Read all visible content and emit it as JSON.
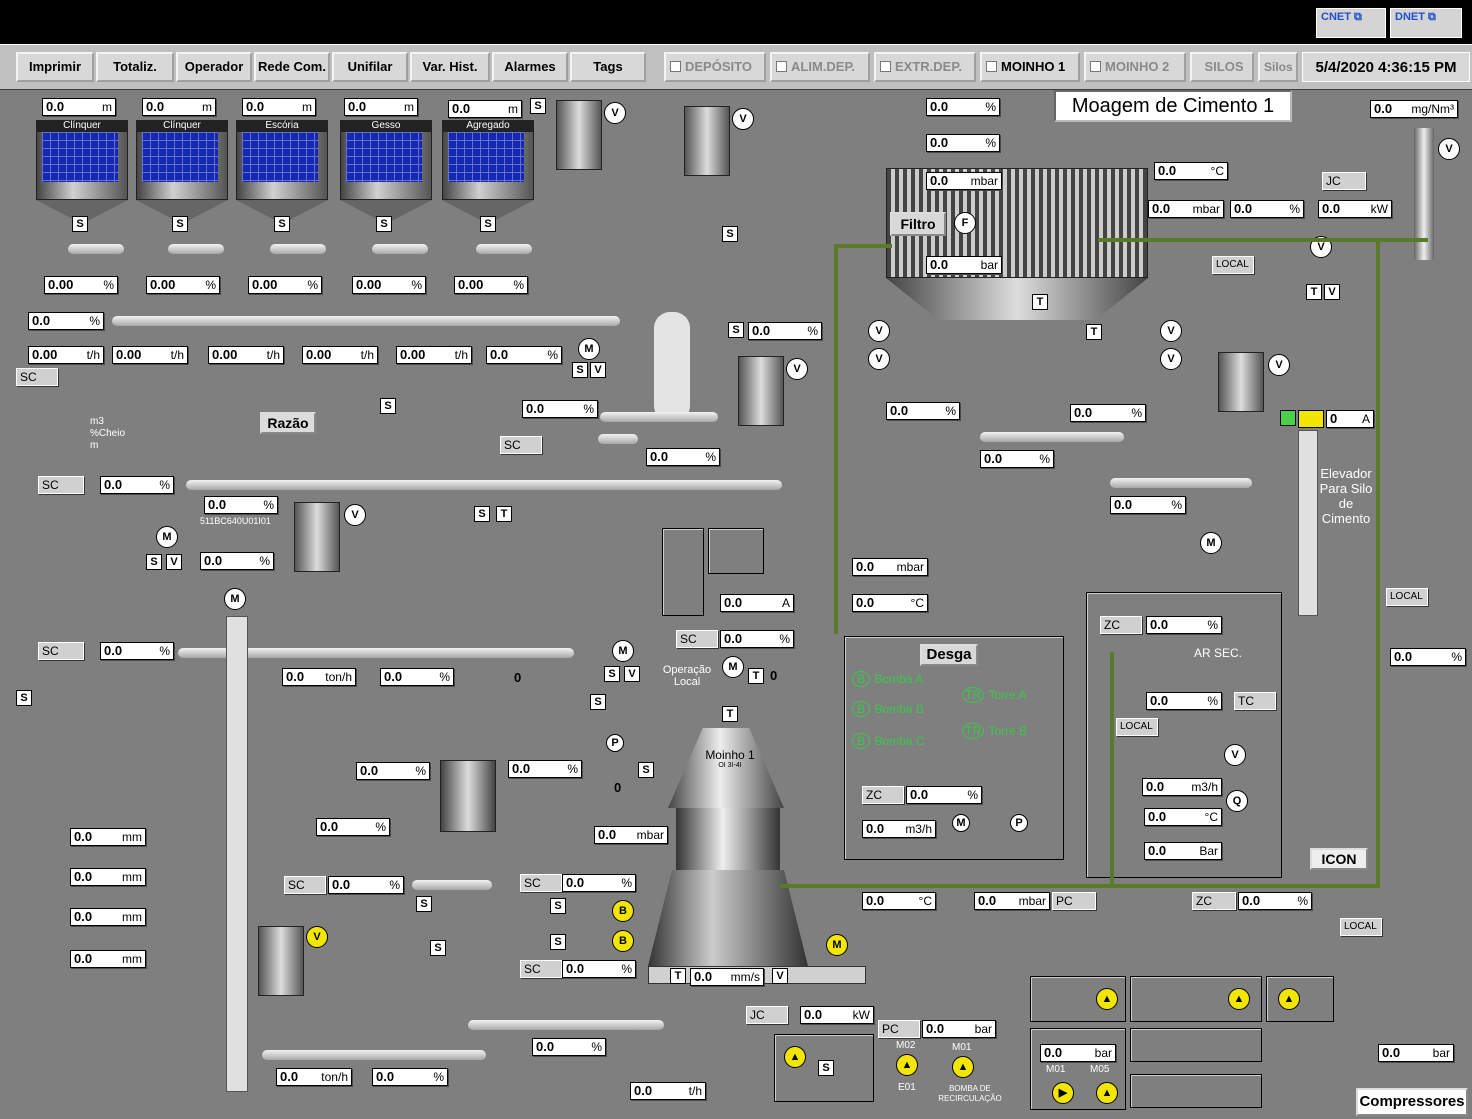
{
  "net": {
    "cnet": "CNET",
    "dnet": "DNET"
  },
  "menu": [
    "Imprimir",
    "Totaliz.",
    "Operador",
    "Rede Com.",
    "Unifilar",
    "Var. Hist.",
    "Alarmes",
    "Tags"
  ],
  "areas": [
    {
      "label": "DEPÓSITO",
      "active": false
    },
    {
      "label": "ALIM.DEP.",
      "active": false
    },
    {
      "label": "EXTR.DEP.",
      "active": false
    },
    {
      "label": "MOINHO 1",
      "active": true
    },
    {
      "label": "MOINHO 2",
      "active": false
    },
    {
      "label": "SILOS",
      "active": false
    },
    {
      "label": "Silos",
      "active": false
    }
  ],
  "datetime": "5/4/2020  4:36:15 PM",
  "title": "Moagem de Cimento 1",
  "silos": [
    {
      "label": "Clínquer",
      "top": "0.0",
      "unit": "m",
      "pct": "0.00"
    },
    {
      "label": "Clínquer",
      "top": "0.0",
      "unit": "m",
      "pct": "0.00"
    },
    {
      "label": "Escória",
      "top": "0.0",
      "unit": "m",
      "pct": "0.00"
    },
    {
      "label": "Gesso",
      "top": "0.0",
      "unit": "m",
      "pct": "0.00"
    },
    {
      "label": "Agregado",
      "top": "0.0",
      "unit": "m",
      "pct": "0.00"
    }
  ],
  "flows": [
    {
      "v": "0.00",
      "u": "t/h"
    },
    {
      "v": "0.00",
      "u": "t/h"
    },
    {
      "v": "0.00",
      "u": "t/h"
    },
    {
      "v": "0.00",
      "u": "t/h"
    },
    {
      "v": "0.00",
      "u": "t/h"
    },
    {
      "v": "0.0",
      "u": "%"
    }
  ],
  "labels": {
    "razao": "Razão",
    "m3": "m3",
    "cheio": "%Cheio",
    "m": "m",
    "tag511": "511BC640U01I01",
    "filtro": "Filtro",
    "elevador": "Elevador Para Silo de Cimento",
    "moinho": "Moinho 1",
    "moinho_sub": "OI 3I-4I",
    "operacao": "Operação Local",
    "desga": "Desga",
    "bomba_a": "Bomba A",
    "bomba_b": "Bomba B",
    "bomba_c": "Bomba C",
    "torre_a": "Torre A",
    "torre_b": "Torre B",
    "ar_sec": "AR SEC.",
    "icon": "ICON",
    "compressores": "Compressores",
    "local": "LOCAL",
    "bomba_recirc": "BOMBA DE RECIRCULAÇÃO",
    "m02": "M02",
    "m01": "M01",
    "e01": "E01",
    "m05": "M05",
    "zero": "0"
  },
  "fields": {
    "pct": "%",
    "zero": "0.0",
    "mgnm3": "mg/Nm³",
    "degc": "°C",
    "mbar": "mbar",
    "kw": "kW",
    "bar": "bar",
    "th": "t/h",
    "tonh": "ton/h",
    "mm": "mm",
    "a": "A",
    "m3h": "m3/h",
    "mms": "mm/s",
    "bar_cap": "Bar"
  },
  "tags": {
    "sc": "SC",
    "zc": "ZC",
    "jc": "JC",
    "pc": "PC",
    "tc": "TC"
  }
}
